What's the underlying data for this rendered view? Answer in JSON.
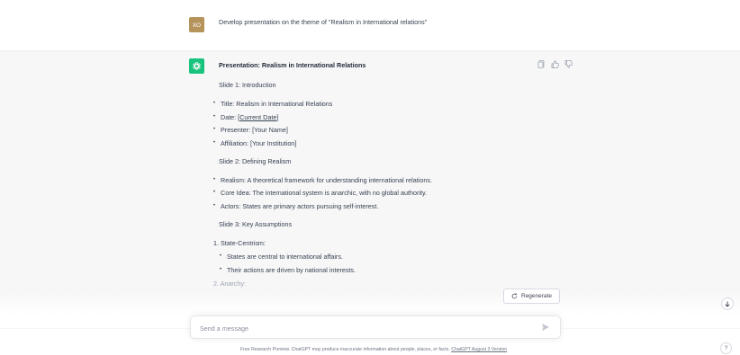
{
  "user_message": {
    "avatar_initials": "XO",
    "avatar_color": "#b5935b",
    "text": "Develop presentation on the theme of \"Realism in International relations\""
  },
  "assistant_message": {
    "avatar_color": "#19c37d",
    "title": "Presentation: Realism in International Relations",
    "slide1": {
      "heading": "Slide 1: Introduction",
      "items": [
        "Title: Realism in International Relations",
        "Date: [",
        "Presenter: [Your Name]",
        "Affiliation: [Your Institution]"
      ],
      "date_link": "Current Date",
      "date_close": "]"
    },
    "slide2": {
      "heading": "Slide 2: Defining Realism",
      "items": [
        "Realism: A theoretical framework for understanding international relations.",
        "Core Idea: The international system is anarchic, with no global authority.",
        "Actors: States are primary actors pursuing self-interest."
      ]
    },
    "slide3": {
      "heading": "Slide 3: Key Assumptions",
      "items": [
        {
          "label": "1. State-Centrism:",
          "sub": [
            "States are central to international affairs.",
            "Their actions are driven by national interests."
          ]
        },
        {
          "label": "2. Anarchy:"
        }
      ]
    }
  },
  "regenerate_label": "Regenerate",
  "composer": {
    "placeholder": "Send a message"
  },
  "footer": {
    "text": "Free Research Preview. ChatGPT may produce inaccurate information about people, places, or facts. ",
    "link": "ChatGPT August 3 Version"
  },
  "help_label": "?",
  "icons": {
    "sidebar_toggle": "sidebar-toggle-icon",
    "copy": "copy-icon",
    "thumbs_up": "thumbs-up-icon",
    "thumbs_down": "thumbs-down-icon",
    "regenerate": "refresh-icon",
    "send": "send-icon",
    "scroll_down": "arrow-down-icon"
  }
}
